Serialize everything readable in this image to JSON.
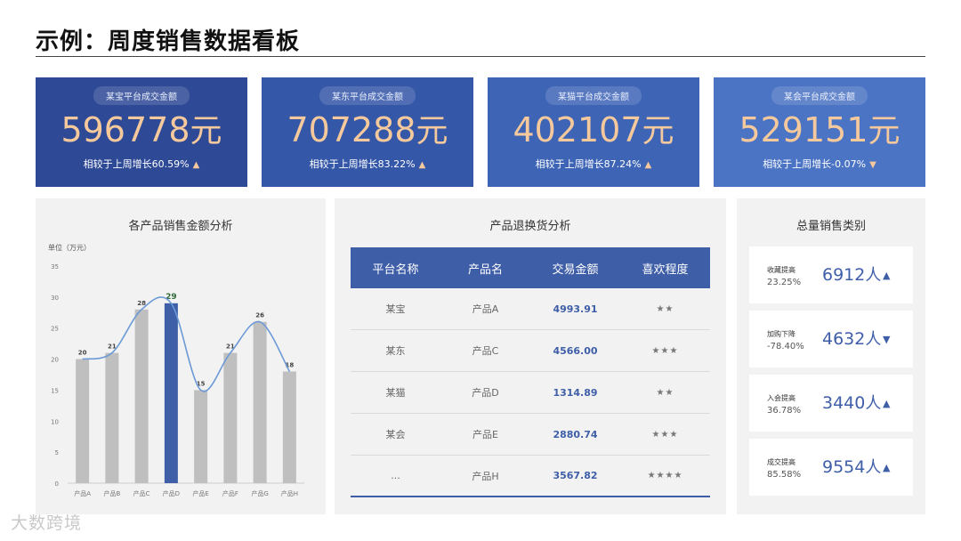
{
  "page_title": "示例：周度销售数据看板",
  "kpis": [
    {
      "label": "某宝平台成交金额",
      "value": "596778",
      "unit": "元",
      "compare": "相较于上周增长60.59%",
      "arrow": "▲",
      "color": "#2e4a96"
    },
    {
      "label": "某东平台成交金额",
      "value": "707288",
      "unit": "元",
      "compare": "相较于上周增长83.22%",
      "arrow": "▲",
      "color": "#3557a8"
    },
    {
      "label": "某猫平台成交金额",
      "value": "402107",
      "unit": "元",
      "compare": "相较于上周增长87.24%",
      "arrow": "▲",
      "color": "#3e64b6"
    },
    {
      "label": "某会平台成交金额",
      "value": "529151",
      "unit": "元",
      "compare": "相较于上周增长-0.07%",
      "arrow": "▼",
      "color": "#4b74c4"
    }
  ],
  "chart_panel": {
    "title": "各产品销售金额分析"
  },
  "chart_data": {
    "type": "bar",
    "title": "各产品销售金额分析",
    "ylabel": "单位（万元）",
    "categories": [
      "产品A",
      "产品B",
      "产品C",
      "产品D",
      "产品E",
      "产品F",
      "产品G",
      "产品H"
    ],
    "values": [
      20,
      21,
      28,
      29,
      15,
      21,
      26,
      18
    ],
    "highlight_index": 3,
    "ylim": [
      0,
      35
    ],
    "yticks": [
      0,
      5,
      10,
      15,
      20,
      25,
      30,
      35
    ],
    "overlay_line": true,
    "colors": {
      "bar": "#bfbfbf",
      "highlight": "#3f5ea8",
      "line": "#6b9ad6"
    }
  },
  "table_panel": {
    "title": "产品退换货分析",
    "headers": [
      "平台名称",
      "产品名",
      "交易金额",
      "喜欢程度"
    ],
    "rows": [
      [
        "某宝",
        "产品A",
        "4993.91",
        "★★"
      ],
      [
        "某东",
        "产品C",
        "4566.00",
        "★★★"
      ],
      [
        "某猫",
        "产品D",
        "1314.89",
        "★★"
      ],
      [
        "某会",
        "产品E",
        "2880.74",
        "★★★"
      ],
      [
        "...",
        "产品H",
        "3567.82",
        "★★★★"
      ]
    ]
  },
  "category_panel": {
    "title": "总量销售类别",
    "cards": [
      {
        "label": "收藏提高",
        "pct": "23.25%",
        "value": "6912",
        "unit": "人",
        "arrow": "▲"
      },
      {
        "label": "加购下降",
        "pct": "-78.40%",
        "value": "4632",
        "unit": "人",
        "arrow": "▼"
      },
      {
        "label": "入会提高",
        "pct": "36.78%",
        "value": "3440",
        "unit": "人",
        "arrow": "▲"
      },
      {
        "label": "成交提高",
        "pct": "85.58%",
        "value": "9554",
        "unit": "人",
        "arrow": "▲"
      }
    ]
  },
  "watermark": "大数跨境"
}
